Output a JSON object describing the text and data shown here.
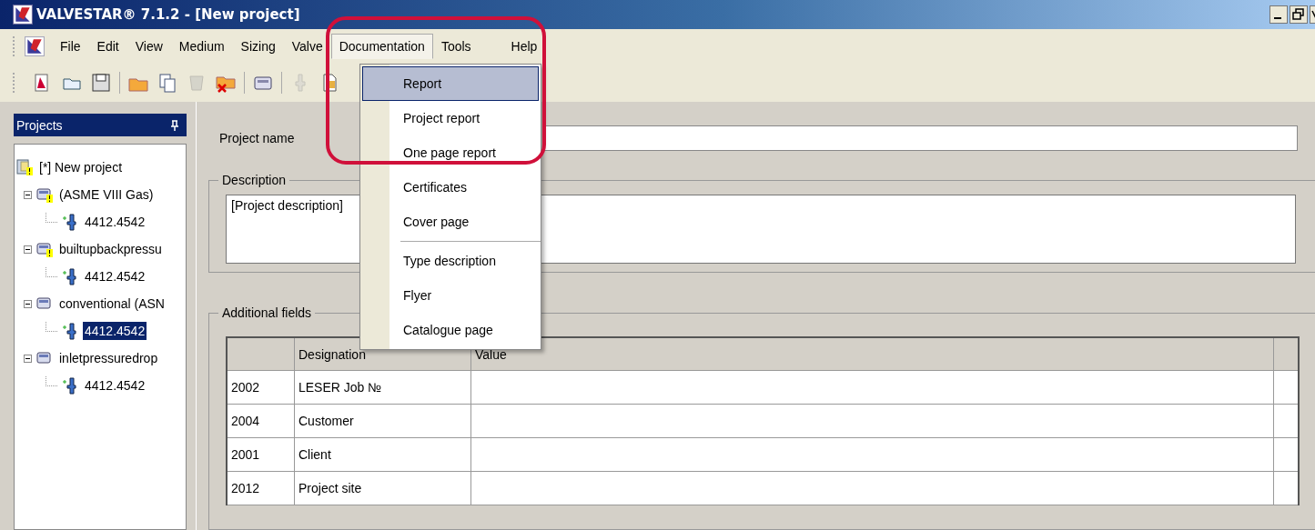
{
  "window": {
    "title": "VALVESTAR® 7.1.2 - [New project]"
  },
  "menu_bar": [
    {
      "label": "File",
      "selected": false
    },
    {
      "label": "Edit",
      "selected": false
    },
    {
      "label": "View",
      "selected": false
    },
    {
      "label": "Medium",
      "selected": false
    },
    {
      "label": "Sizing",
      "selected": false
    },
    {
      "label": "Valve",
      "selected": false
    },
    {
      "label": "Documentation",
      "selected": true
    },
    {
      "label": "Tools",
      "selected": false
    },
    {
      "label": "Help",
      "selected": false
    }
  ],
  "toolbar": [
    {
      "kind": "new",
      "disabled": false
    },
    {
      "kind": "open",
      "disabled": false
    },
    {
      "kind": "save",
      "disabled": false
    },
    {
      "kind": "sep"
    },
    {
      "kind": "folder",
      "disabled": false
    },
    {
      "kind": "copy",
      "disabled": false
    },
    {
      "kind": "cup",
      "disabled": true
    },
    {
      "kind": "delete",
      "disabled": false
    },
    {
      "kind": "sep"
    },
    {
      "kind": "calc",
      "disabled": false
    },
    {
      "kind": "sep"
    },
    {
      "kind": "valve",
      "disabled": true
    },
    {
      "kind": "doc",
      "disabled": false
    }
  ],
  "documentation_menu": [
    {
      "label": "Report",
      "selected": true
    },
    {
      "label": "Project report",
      "selected": false
    },
    {
      "label": "One page report",
      "selected": false
    },
    {
      "label": "Certificates",
      "selected": false
    },
    {
      "label": "Cover page",
      "selected": false,
      "separator_after": true
    },
    {
      "label": "Type description",
      "selected": false
    },
    {
      "label": "Flyer",
      "selected": false
    },
    {
      "label": "Catalogue page",
      "selected": false
    }
  ],
  "projects_panel": {
    "title": "Projects",
    "tree": [
      {
        "label": "[*] New project",
        "kind": "project",
        "warning": true,
        "selected": false,
        "children": [
          {
            "label": "(ASME VIII Gas)",
            "kind": "calc",
            "warning": true,
            "selected": false,
            "expanded": true,
            "children": [
              {
                "label": "4412.4542",
                "kind": "valve",
                "selected": false
              }
            ]
          },
          {
            "label": "builtupbackpressu",
            "kind": "calc",
            "warning": true,
            "selected": false,
            "expanded": true,
            "children": [
              {
                "label": "4412.4542",
                "kind": "valve",
                "selected": false
              }
            ]
          },
          {
            "label": "conventional (ASN",
            "kind": "calc",
            "warning": false,
            "selected": false,
            "expanded": true,
            "children": [
              {
                "label": "4412.4542",
                "kind": "valve",
                "selected": true
              }
            ]
          },
          {
            "label": "inletpressuredrop",
            "kind": "calc",
            "warning": false,
            "selected": false,
            "expanded": true,
            "children": [
              {
                "label": "4412.4542",
                "kind": "valve",
                "selected": false
              }
            ]
          }
        ]
      }
    ]
  },
  "project_name": {
    "label": "Project name"
  },
  "description": {
    "legend": "Description",
    "value": "[Project description]"
  },
  "additional_fields": {
    "legend": "Additional fields",
    "columns": [
      "Designation",
      "Value"
    ],
    "rows": [
      {
        "code": "2002",
        "designation": "LESER Job №"
      },
      {
        "code": "2004",
        "designation": "Customer"
      },
      {
        "code": "2001",
        "designation": "Client"
      },
      {
        "code": "2012",
        "designation": "Project site"
      }
    ]
  }
}
